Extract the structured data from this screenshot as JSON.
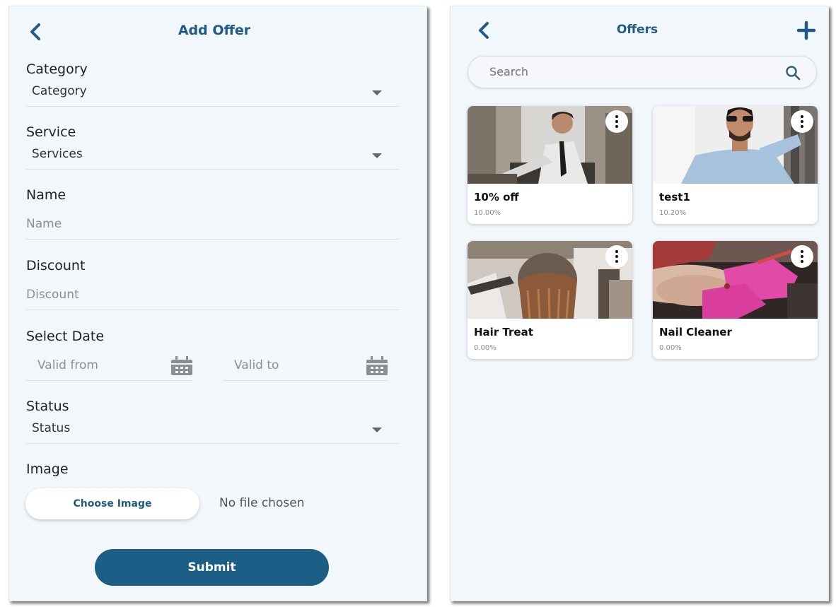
{
  "add_offer": {
    "title": "Add Offer",
    "category": {
      "label": "Category",
      "value": "Category"
    },
    "service": {
      "label": "Service",
      "value": "Services"
    },
    "name": {
      "label": "Name",
      "placeholder": "Name"
    },
    "discount": {
      "label": "Discount",
      "placeholder": "Discount"
    },
    "date": {
      "label": "Select Date",
      "from_placeholder": "Valid from",
      "to_placeholder": "Valid to"
    },
    "status": {
      "label": "Status",
      "value": "Status"
    },
    "image": {
      "label": "Image",
      "button": "Choose Image",
      "file_text": "No file chosen"
    },
    "submit": "Submit"
  },
  "offers": {
    "title": "Offers",
    "search_placeholder": "Search",
    "cards": [
      {
        "name": "10% off",
        "discount": "10.00%"
      },
      {
        "name": "test1",
        "discount": "10.20%"
      },
      {
        "name": "Hair Treat",
        "discount": "0.00%"
      },
      {
        "name": "Nail Cleaner",
        "discount": "0.00%"
      }
    ]
  },
  "colors": {
    "primary": "#1d5e87",
    "title": "#1f5b86",
    "background": "#f2f7fc"
  },
  "icons": {
    "back": "chevron-left-icon",
    "add": "plus-icon",
    "search": "search-icon",
    "calendar": "calendar-icon",
    "more": "more-vertical-icon",
    "dropdown": "caret-down-icon"
  }
}
